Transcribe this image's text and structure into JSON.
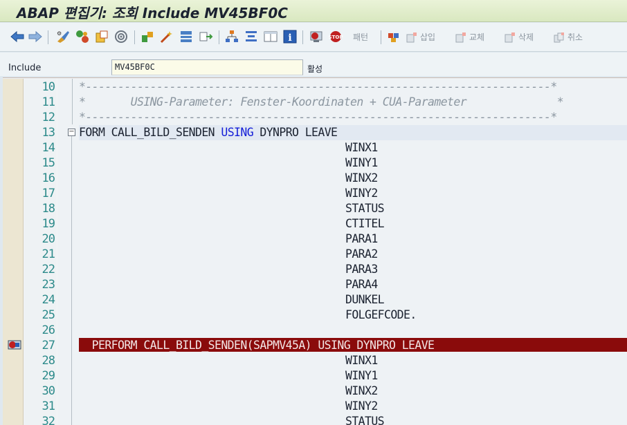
{
  "window": {
    "title": "ABAP 편집기: 조회 Include MV45BF0C"
  },
  "toolbar": {
    "pattern_label": "패턴",
    "insert_label": "삽입",
    "replace_label": "교체",
    "delete_label": "삭제",
    "cancel_label": "취소"
  },
  "include": {
    "label": "Include",
    "value": "MV45BF0C",
    "status": "활성"
  },
  "editor": {
    "lines": [
      {
        "no": "10",
        "text": "*------------------------------------------------------------------------*"
      },
      {
        "no": "11",
        "text": "*       USING-Parameter: Fenster-Koordinaten + CUA-Parameter              *"
      },
      {
        "no": "12",
        "text": "*------------------------------------------------------------------------*"
      },
      {
        "no": "13",
        "kw1": "FORM",
        "t1": " CALL_BILD_SENDEN ",
        "kw2": "USING",
        "t2": " DYNPRO LEAVE"
      },
      {
        "no": "14",
        "text": "WINX1"
      },
      {
        "no": "15",
        "text": "WINY1"
      },
      {
        "no": "16",
        "text": "WINX2"
      },
      {
        "no": "17",
        "text": "WINY2"
      },
      {
        "no": "18",
        "text": "STATUS"
      },
      {
        "no": "19",
        "text": "CTITEL"
      },
      {
        "no": "20",
        "text": "PARA1"
      },
      {
        "no": "21",
        "text": "PARA2"
      },
      {
        "no": "22",
        "text": "PARA3"
      },
      {
        "no": "23",
        "text": "PARA4"
      },
      {
        "no": "24",
        "text": "DUNKEL"
      },
      {
        "no": "25",
        "text": "FOLGEFCODE."
      },
      {
        "no": "26",
        "text": ""
      },
      {
        "no": "27",
        "text": "  PERFORM CALL_BILD_SENDEN(SAPMV45A) USING DYNPRO LEAVE"
      },
      {
        "no": "28",
        "text": "WINX1"
      },
      {
        "no": "29",
        "text": "WINY1"
      },
      {
        "no": "30",
        "text": "WINX2"
      },
      {
        "no": "31",
        "text": "WINY2"
      },
      {
        "no": "32",
        "text": "STATUS"
      }
    ]
  },
  "colors": {
    "breakpoint_bg": "#8a0b0b",
    "keyword": "#1620d8",
    "line_number": "#2c8a8a"
  }
}
